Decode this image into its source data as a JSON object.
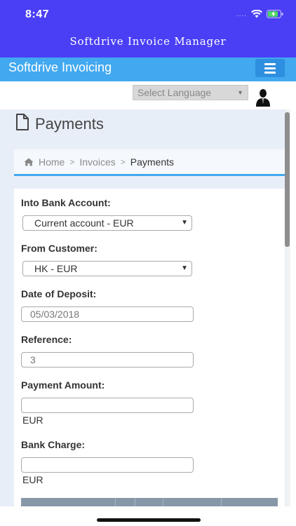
{
  "status_bar": {
    "time": "8:47",
    "signal": "...."
  },
  "app": {
    "title": "Softdrive Invoice Manager"
  },
  "nav": {
    "brand": "Softdrive Invoicing"
  },
  "language": {
    "placeholder": "Select Language"
  },
  "page": {
    "title": "Payments"
  },
  "breadcrumb": {
    "home": "Home",
    "invoices": "Invoices",
    "current": "Payments"
  },
  "form": {
    "bank_account_label": "Into Bank Account:",
    "bank_account_value": "Current account - EUR",
    "customer_label": "From Customer:",
    "customer_value": "HK - EUR",
    "date_label": "Date of Deposit:",
    "date_value": "05/03/2018",
    "reference_label": "Reference:",
    "reference_value": "3",
    "amount_label": "Payment Amount:",
    "amount_value": "",
    "amount_currency": "EUR",
    "charge_label": "Bank Charge:",
    "charge_value": "",
    "charge_currency": "EUR"
  },
  "colors": {
    "status_bg": "#4a3ff5",
    "nav_bg": "#42a9f0",
    "menu_button": "#2e8fe0",
    "content_bg": "#e8eef8",
    "table_header": "#8697a8"
  }
}
